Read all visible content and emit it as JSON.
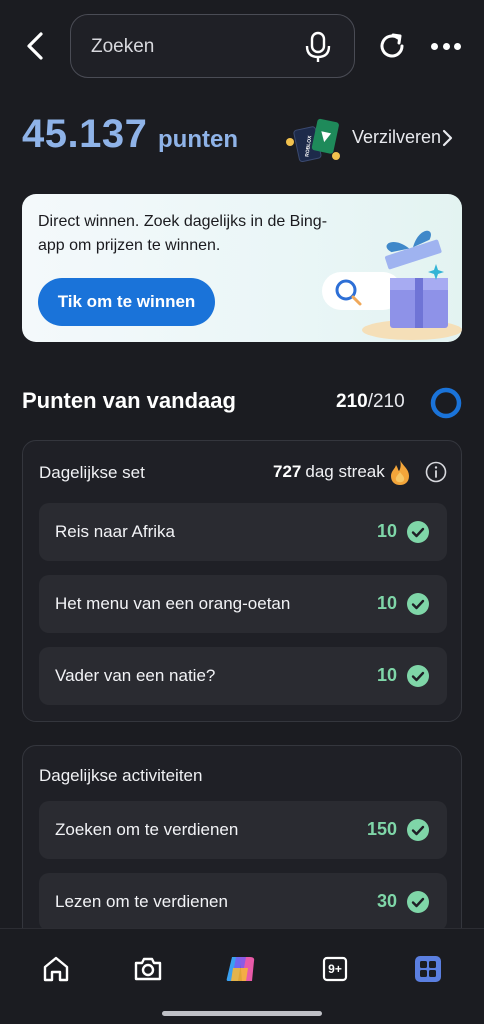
{
  "topbar": {
    "search_placeholder": "Zoeken",
    "back_icon": "chevron-left-icon",
    "mic_icon": "microphone-icon",
    "refresh_icon": "refresh-icon",
    "more_icon": "more-horizontal-icon"
  },
  "points": {
    "value": "45.137",
    "unit": "punten",
    "redeem_label": "Verzilveren",
    "card_text": "ROBLOX"
  },
  "promo": {
    "text": "Direct winnen. Zoek dagelijks in de Bing-app om prijzen te winnen.",
    "button_label": "Tik om te winnen"
  },
  "today": {
    "title": "Punten van vandaag",
    "earned": "210",
    "total": "/210",
    "progress": 1.0
  },
  "daily_set": {
    "title": "Dagelijkse set",
    "streak_number": "727",
    "streak_label": "dag streak",
    "items": [
      {
        "label": "Reis naar Afrika",
        "points": "10",
        "completed": true
      },
      {
        "label": "Het menu van een orang-oetan",
        "points": "10",
        "completed": true
      },
      {
        "label": "Vader van een natie?",
        "points": "10",
        "completed": true
      }
    ]
  },
  "daily_activities": {
    "title": "Dagelijkse activiteiten",
    "items": [
      {
        "label": "Zoeken om te verdienen",
        "points": "150",
        "completed": true
      },
      {
        "label": "Lezen om te verdienen",
        "points": "30",
        "completed": true
      }
    ]
  },
  "bottom_nav": {
    "items": [
      {
        "icon": "home-icon"
      },
      {
        "icon": "camera-icon"
      },
      {
        "icon": "copilot-icon"
      },
      {
        "icon": "tabs-icon",
        "badge": "9+"
      },
      {
        "icon": "apps-grid-icon",
        "active": true
      }
    ]
  },
  "colors": {
    "background": "#1b1c21",
    "points_accent": "#8fb3e8",
    "button_blue": "#1a73d9",
    "success_green": "#7fd6a8",
    "ring_blue": "#1a73d9"
  }
}
